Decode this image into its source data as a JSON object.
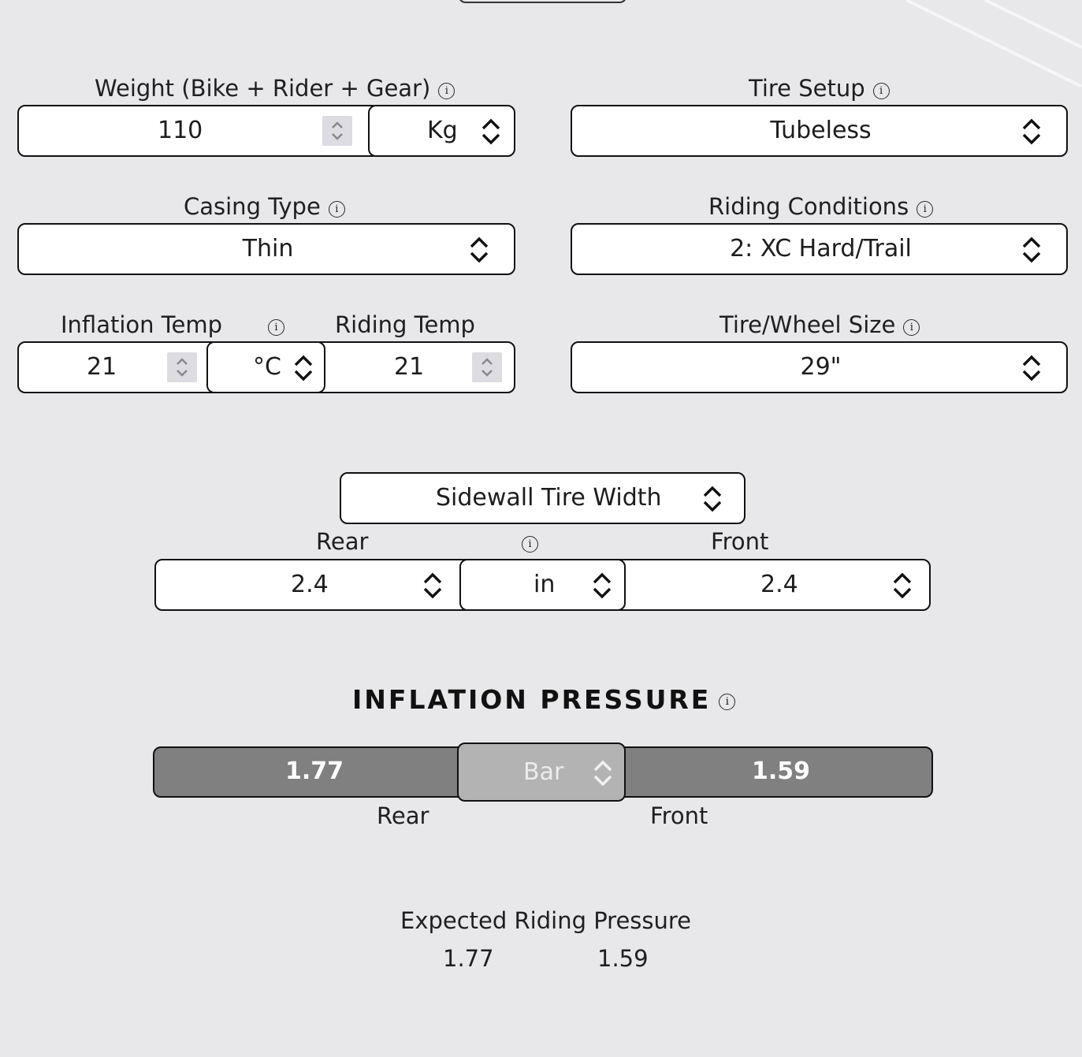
{
  "weight": {
    "label": "Weight (Bike + Rider + Gear)",
    "value": "110",
    "unit": "Kg",
    "info": "i"
  },
  "tire_setup": {
    "label": "Tire Setup",
    "value": "Tubeless",
    "info": "i"
  },
  "casing_type": {
    "label": "Casing Type",
    "value": "Thin",
    "info": "i"
  },
  "riding_conditions": {
    "label": "Riding Conditions",
    "value": "2: XC Hard/Trail",
    "info": "i"
  },
  "temps": {
    "inflation_label": "Inflation Temp",
    "riding_label": "Riding Temp",
    "inflation_value": "21",
    "unit": "°C",
    "riding_value": "21",
    "info": "i"
  },
  "wheel_size": {
    "label": "Tire/Wheel Size",
    "value": "29\"",
    "info": "i"
  },
  "tire_width": {
    "mode": "Sidewall Tire Width",
    "rear_label": "Rear",
    "front_label": "Front",
    "rear_value": "2.4",
    "unit": "in",
    "front_value": "2.4",
    "info": "i"
  },
  "inflation_pressure": {
    "heading": "INFLATION PRESSURE",
    "info": "i",
    "rear_value": "1.77",
    "unit": "Bar",
    "front_value": "1.59",
    "rear_label": "Rear",
    "front_label": "Front"
  },
  "expected": {
    "title": "Expected Riding Pressure",
    "rear_value": "1.77",
    "front_value": "1.59"
  },
  "colors": {
    "background": "#e8e8ea",
    "field": "#ffffff",
    "border": "#111111",
    "pressure_bar": "#808080",
    "pressure_unit": "#b3b3b3"
  },
  "icons": {
    "info": "info-circle-icon",
    "select": "chevron-up-down-icon",
    "spinner": "spinner-arrows-icon"
  }
}
